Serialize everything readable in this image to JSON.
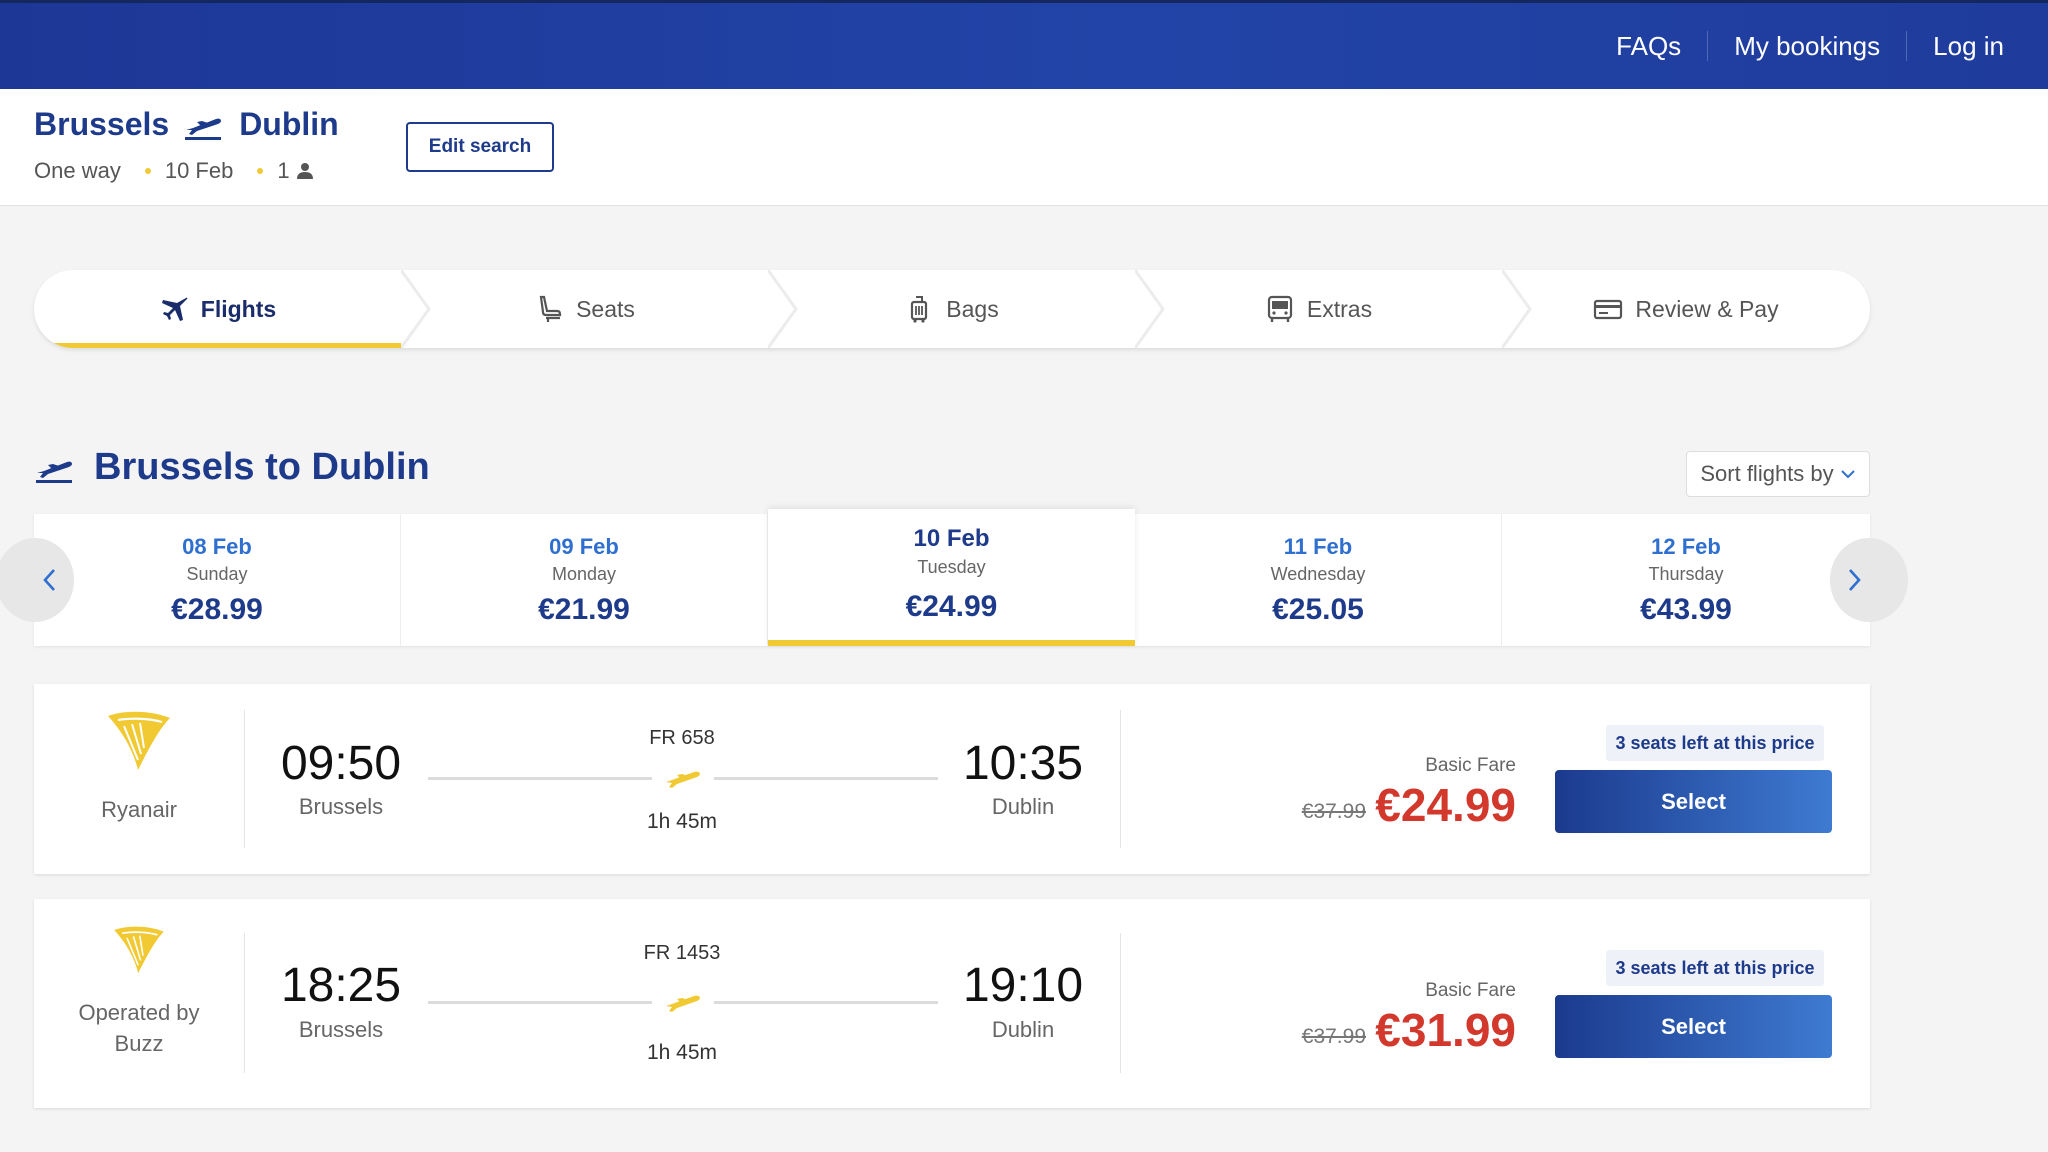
{
  "nav": {
    "faqs": "FAQs",
    "my_bookings": "My bookings",
    "login": "Log in"
  },
  "route": {
    "origin": "Brussels",
    "destination": "Dublin",
    "trip_type": "One way",
    "date": "10 Feb",
    "passengers": "1",
    "edit_label": "Edit search"
  },
  "steps": [
    {
      "label": "Flights",
      "icon": "plane-icon"
    },
    {
      "label": "Seats",
      "icon": "seat-icon"
    },
    {
      "label": "Bags",
      "icon": "luggage-icon"
    },
    {
      "label": "Extras",
      "icon": "bus-icon"
    },
    {
      "label": "Review & Pay",
      "icon": "credit-card-icon"
    }
  ],
  "results": {
    "title": "Brussels to Dublin",
    "sort_label": "Sort flights by"
  },
  "dates": [
    {
      "date": "08 Feb",
      "weekday": "Sunday",
      "price": "€28.99"
    },
    {
      "date": "09 Feb",
      "weekday": "Monday",
      "price": "€21.99"
    },
    {
      "date": "10 Feb",
      "weekday": "Tuesday",
      "price": "€24.99"
    },
    {
      "date": "11 Feb",
      "weekday": "Wednesday",
      "price": "€25.05"
    },
    {
      "date": "12 Feb",
      "weekday": "Thursday",
      "price": "€43.99"
    }
  ],
  "flights": [
    {
      "airline": "Ryanair",
      "depart_time": "09:50",
      "depart_city": "Brussels",
      "flight_no": "FR 658",
      "duration": "1h 45m",
      "arrive_time": "10:35",
      "arrive_city": "Dublin",
      "fare_name": "Basic Fare",
      "old_price": "€37.99",
      "price": "€24.99",
      "seats_note": "3 seats left at this price",
      "select_label": "Select"
    },
    {
      "airline_line1": "Operated by",
      "airline_line2": "Buzz",
      "depart_time": "18:25",
      "depart_city": "Brussels",
      "flight_no": "FR 1453",
      "duration": "1h 45m",
      "arrive_time": "19:10",
      "arrive_city": "Dublin",
      "fare_name": "Basic Fare",
      "old_price": "€37.99",
      "price": "€31.99",
      "seats_note": "3 seats left at this price",
      "select_label": "Select"
    }
  ],
  "colors": {
    "brand_blue": "#1e3a8a",
    "accent_yellow": "#f1c933",
    "price_red": "#d2382c"
  }
}
